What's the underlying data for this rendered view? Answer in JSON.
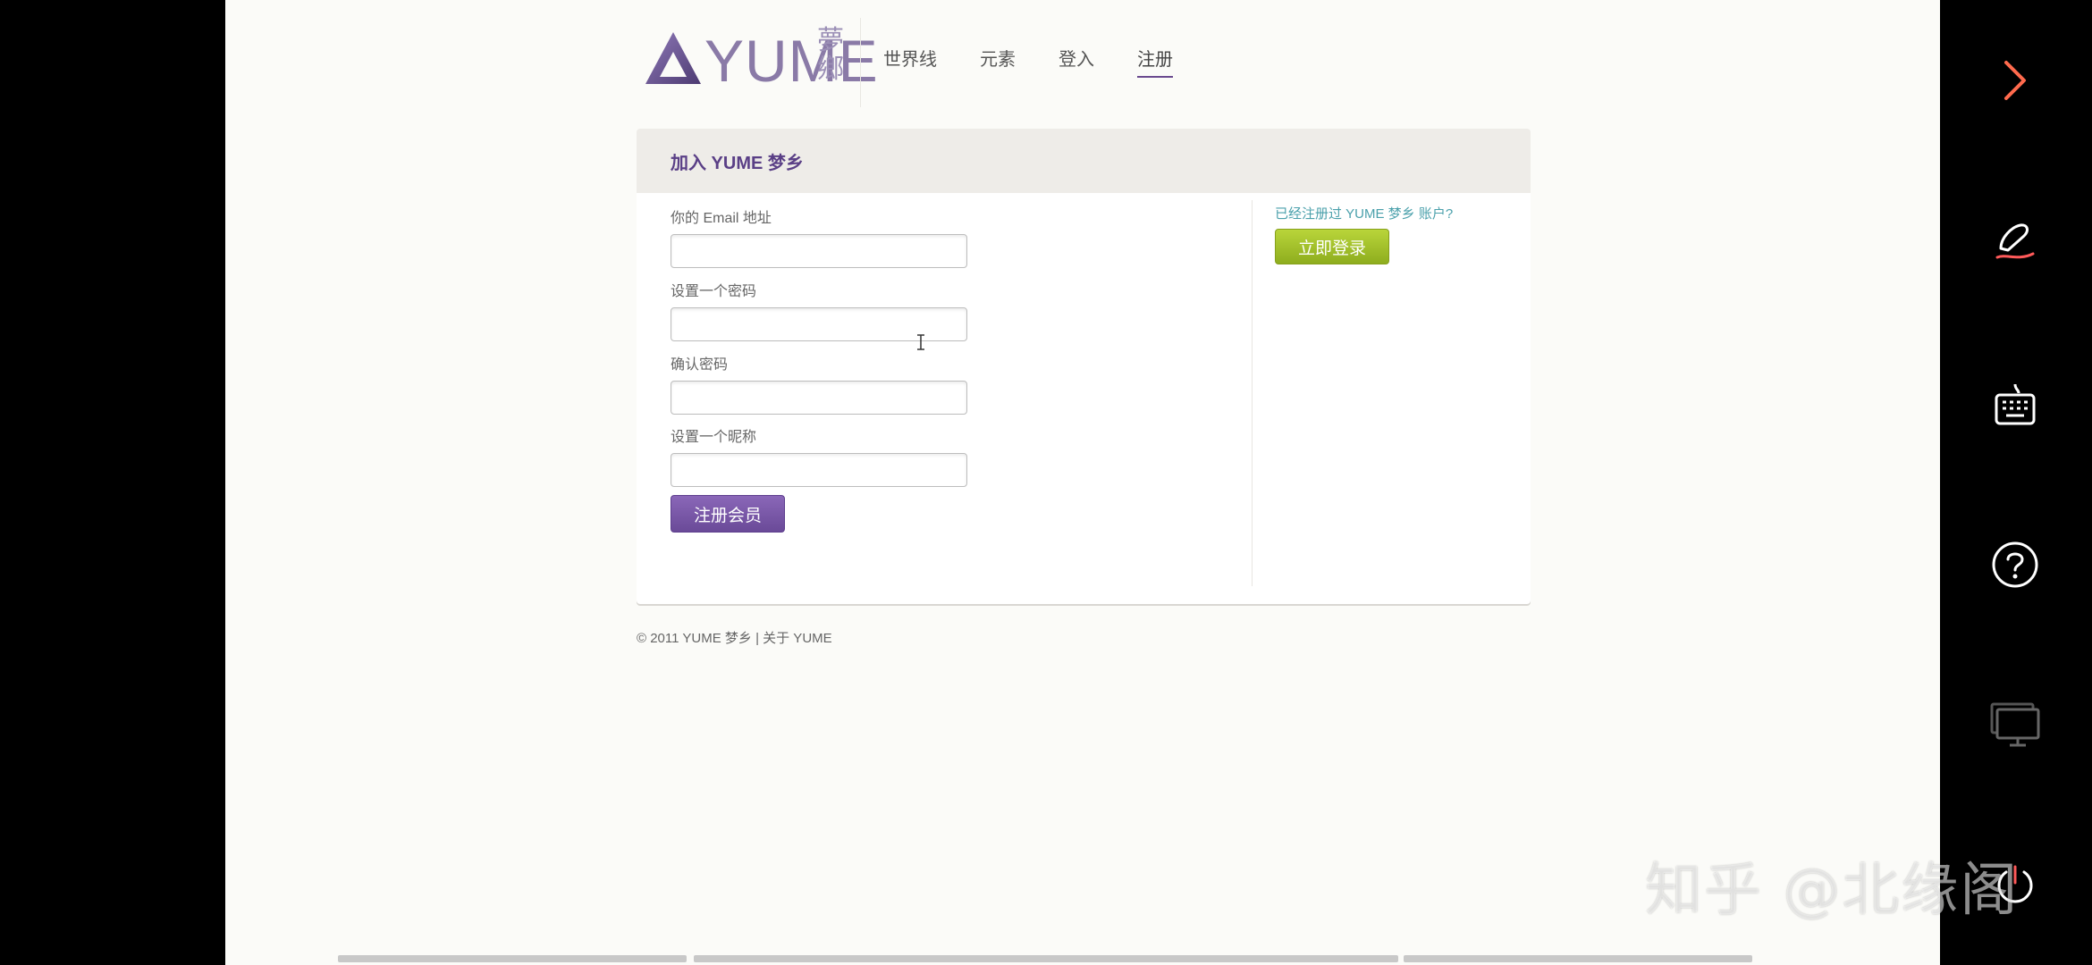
{
  "brand": {
    "logo_word": "YUME",
    "logo_cn": "夢鄉"
  },
  "nav": {
    "items": [
      "世界线",
      "元素",
      "登入",
      "注册"
    ],
    "active": "注册"
  },
  "panel": {
    "title": "加入 YUME 梦乡",
    "fields": [
      {
        "label": "你的 Email 地址",
        "value": ""
      },
      {
        "label": "设置一个密码",
        "value": ""
      },
      {
        "label": "确认密码",
        "value": ""
      },
      {
        "label": "设置一个昵称",
        "value": ""
      }
    ],
    "register_label": "注册会员",
    "already_text": "已经注册过 YUME 梦乡 账户?",
    "login_now_label": "立即登录"
  },
  "footer": {
    "copyright": "© 2011 YUME 梦乡",
    "separator": "|",
    "about": "关于 YUME"
  },
  "watermark": "知乎 @北缘阁",
  "colors": {
    "brand_purple": "#6a4a98",
    "login_green": "#9cbc24",
    "link_teal": "#4aa0ab",
    "accent_orange": "#ff6a4d"
  },
  "sidebar_icons": [
    "chevron-right-icon",
    "pen-icon",
    "keyboard-icon",
    "help-icon",
    "monitor-icon"
  ]
}
